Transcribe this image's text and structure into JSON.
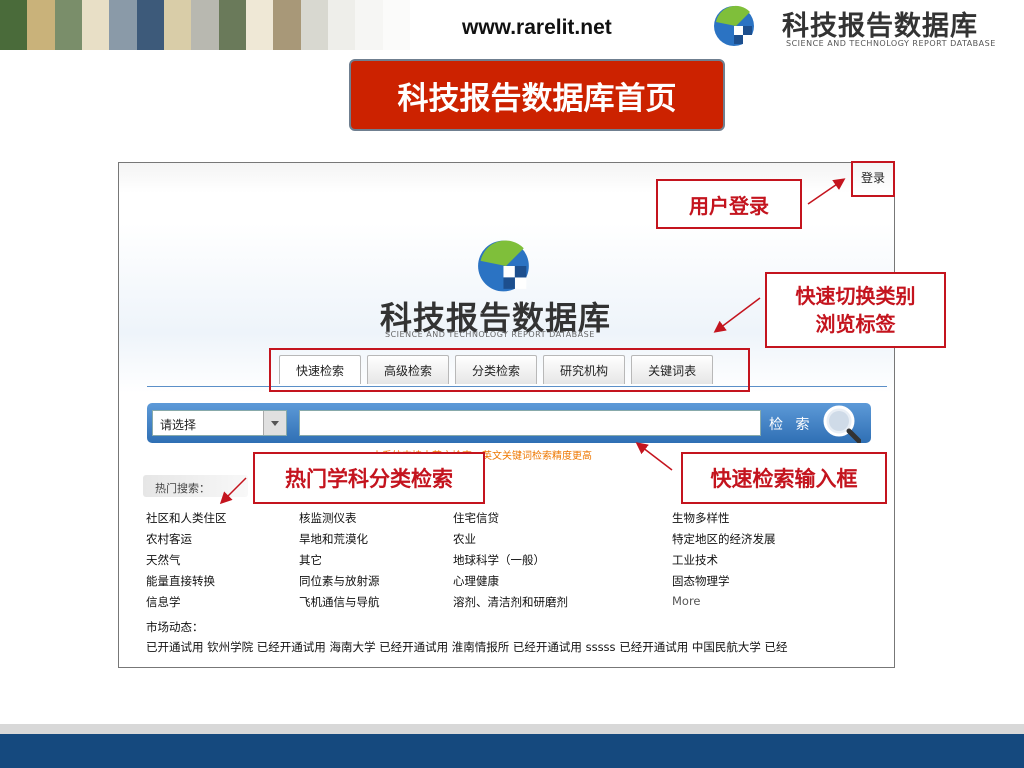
{
  "site_url": "www.rarelit.net",
  "logo": {
    "title": "科技报告数据库",
    "subtitle": "SCIENCE AND TECHNOLOGY REPORT DATABASE"
  },
  "page_title": "科技报告数据库首页",
  "screenshot": {
    "login_link": "登录",
    "tabs": [
      "快速检索",
      "高级检索",
      "分类检索",
      "研究机构",
      "关键词表"
    ],
    "search": {
      "select_value": "请选择",
      "button_label": "检 索",
      "hint": "本系统支持中英文检索，英文关键词检索精度更高"
    },
    "hot_search_label": "热门搜索：",
    "hot_columns": [
      [
        "社区和人类住区",
        "农村客运",
        "天然气",
        "能量直接转换",
        "信息学"
      ],
      [
        "核监测仪表",
        "旱地和荒漠化",
        "其它",
        "同位素与放射源",
        "飞机通信与导航"
      ],
      [
        "住宅信贷",
        "农业",
        "地球科学（一般）",
        "心理健康",
        "溶剂、清洁剂和研磨剂"
      ],
      [
        "生物多样性",
        "特定地区的经济发展",
        "工业技术",
        "固态物理学",
        "More"
      ]
    ],
    "market_label": "市场动态：",
    "market_ticker": "已开通试用  钦州学院  已经开通试用  海南大学  已经开通试用      淮南情报所  已经开通试用  sssss 已经开通试用  中国民航大学  已经"
  },
  "callouts": {
    "user_login": "用户登录",
    "switch_tabs_line1": "快速切换类别",
    "switch_tabs_line2": "浏览标签",
    "hot_category": "热门学科分类检索",
    "quick_search": "快速检索输入框"
  },
  "colors": {
    "title_red": "#cc2200",
    "callout_red": "#c4141e",
    "footer_blue": "#15497e",
    "search_bar_blue": "#2f6fb4",
    "hint_orange": "#ee7700"
  }
}
